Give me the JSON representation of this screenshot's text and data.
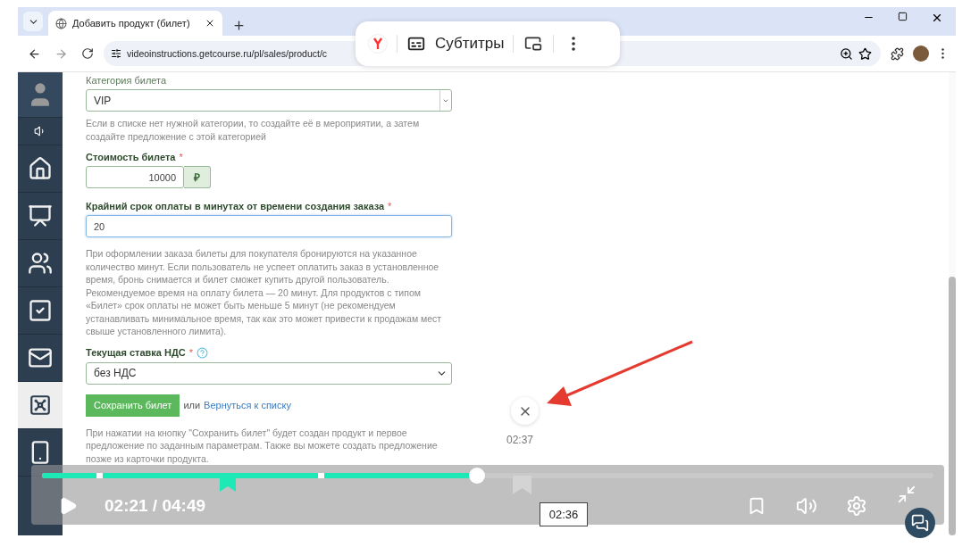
{
  "browser": {
    "tab_title": "Добавить продукт (билет)",
    "url": "videoinstructions.getcourse.ru/pl/sales/product/c"
  },
  "overlay_menu": {
    "subtitles_label": "Субтитры"
  },
  "sidebar": {
    "items": [
      {
        "kind": "avatar",
        "selected": false
      },
      {
        "kind": "speaker",
        "selected": false
      },
      {
        "kind": "home",
        "selected": false
      },
      {
        "kind": "chart",
        "selected": false
      },
      {
        "kind": "people",
        "selected": false
      },
      {
        "kind": "tasks",
        "selected": false
      },
      {
        "kind": "mail",
        "selected": false
      },
      {
        "kind": "safe",
        "selected": true
      },
      {
        "kind": "phone",
        "selected": false
      }
    ]
  },
  "form": {
    "category": {
      "label": "Категория билета",
      "value": "VIP",
      "hint": "Если в списке нет нужной категории, то создайте её в мероприятии, а затем создайте предложение с этой категорией"
    },
    "price": {
      "label": "Стоимость билета",
      "required_mark": "*",
      "value": "10000",
      "currency": "₽"
    },
    "deadline": {
      "label": "Крайний срок оплаты в минутах от времени создания заказа",
      "required_mark": "*",
      "value": "20",
      "focused": true,
      "hint": "При оформлении заказа билеты для покупателя бронируются на указанное количество минут. Если пользователь не успеет оплатить заказ в установленное время, бронь снимается и билет сможет купить другой пользователь. Рекомендуемое время на оплату билета — 20 минут. Для продуктов с типом «Билет» срок оплаты не может быть меньше 5 минут (не рекомендуем устанавливать минимальное время, так как это может привести к продажам мест свыше установленного лимита)."
    },
    "vat": {
      "label": "Текущая ставка НДС",
      "required_mark": "*",
      "value": "без НДС"
    },
    "save_button": "Сохранить билет",
    "or_text": "или",
    "back_link": "Вернуться к списку",
    "note": "При нажатии на кнопку \"Сохранить билет\" будет создан продукт и первое предложение по заданным параметрам. Также вы можете создать предложение позже из карточки продукта."
  },
  "marker": {
    "time": "02:37"
  },
  "player": {
    "time": "02:21 / 04:49",
    "level": 0.488,
    "tooltip": "02:36"
  }
}
